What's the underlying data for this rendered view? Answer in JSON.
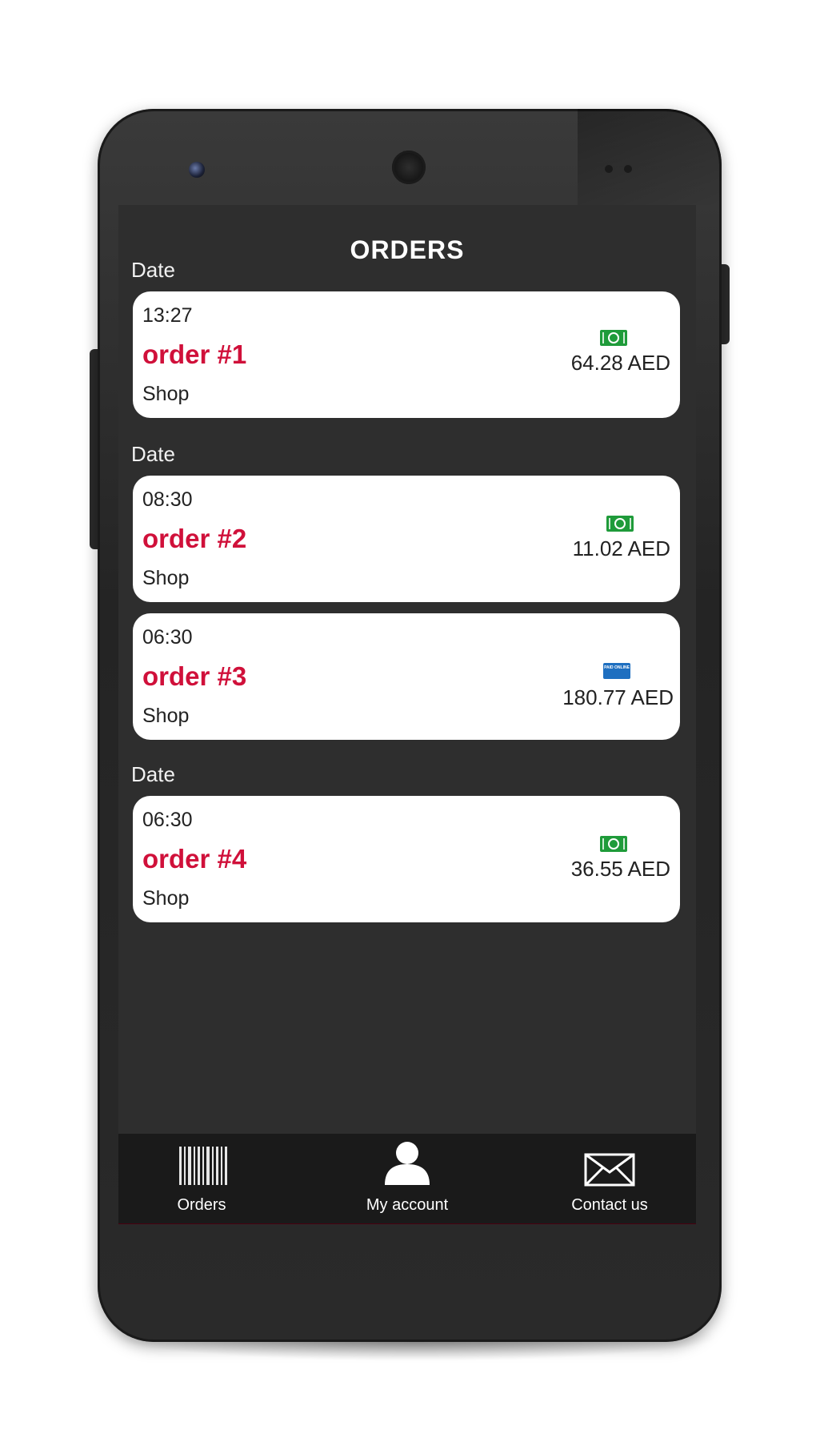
{
  "screen_title": "ORDERS",
  "groups": [
    {
      "date_label": "Date",
      "orders": [
        {
          "time": "13:27",
          "title": "order #1",
          "shop": "Shop",
          "price": "64.28 AED",
          "payment_icon": "cash-icon"
        }
      ]
    },
    {
      "date_label": "Date",
      "orders": [
        {
          "time": "08:30",
          "title": "order #2",
          "shop": "Shop",
          "price": "11.02 AED",
          "payment_icon": "cash-icon"
        },
        {
          "time": "06:30",
          "title": "order #3",
          "shop": "Shop",
          "price": "180.77 AED",
          "payment_icon": "paid-online-icon",
          "payment_icon_text": "PAID ONLINE"
        }
      ]
    },
    {
      "date_label": "Date",
      "orders": [
        {
          "time": "06:30",
          "title": "order #4",
          "shop": "Shop",
          "price": "36.55 AED",
          "payment_icon": "cash-icon"
        }
      ]
    }
  ],
  "bottom_nav": [
    {
      "label": "Orders",
      "icon": "barcode-icon"
    },
    {
      "label": "My account",
      "icon": "user-icon"
    },
    {
      "label": "Contact us",
      "icon": "envelope-icon"
    }
  ],
  "colors": {
    "accent": "#d0103a",
    "screen_bg": "#2e2e2e",
    "nav_bg": "#1a1a1a",
    "cash_green": "#1f9b3a",
    "online_blue": "#1e6fc0"
  }
}
